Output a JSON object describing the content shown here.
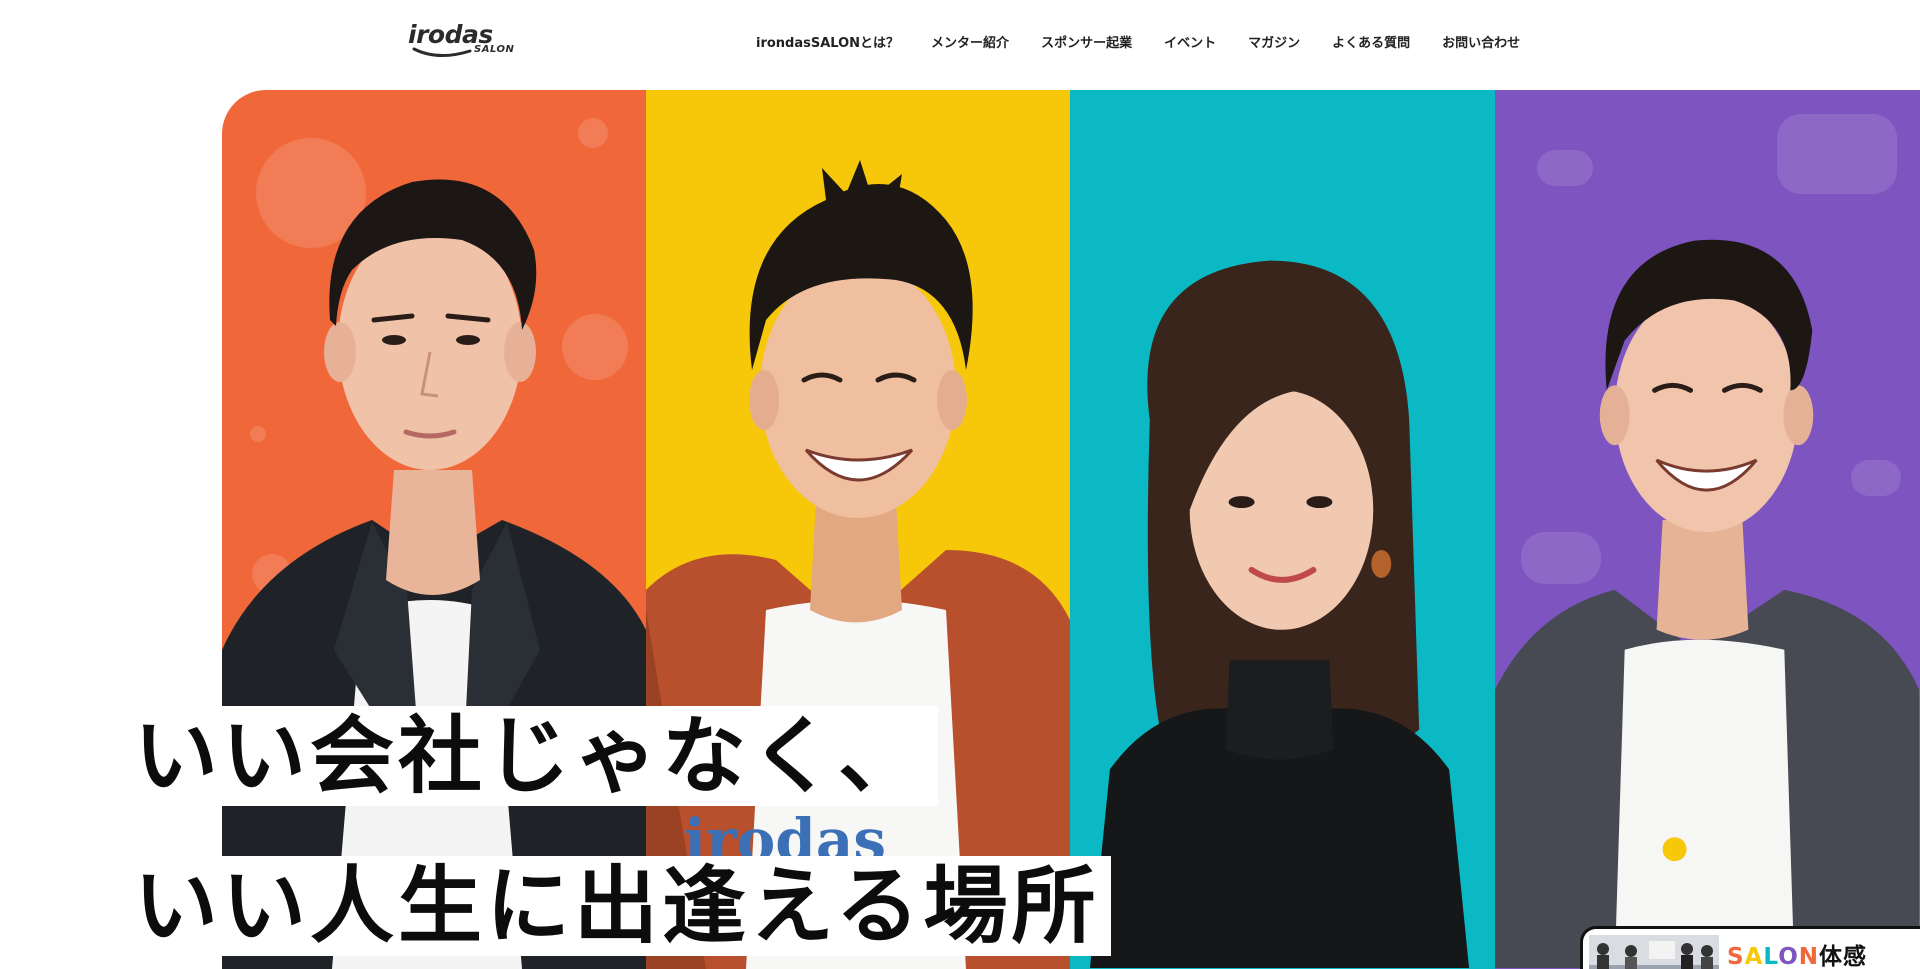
{
  "brand": {
    "logo_word": "irodas",
    "logo_sub": "SALON"
  },
  "nav": {
    "items": [
      {
        "label": "irondasSALONとは？"
      },
      {
        "label": "メンター紹介"
      },
      {
        "label": "スポンサー起業"
      },
      {
        "label": "イベント"
      },
      {
        "label": "マガジン"
      },
      {
        "label": "よくある質問"
      },
      {
        "label": "お問い合わせ"
      }
    ]
  },
  "hero": {
    "catch_line_1": "いい会社じゃなく、",
    "catch_line_2": "いい人生に出逢える場所",
    "panel_colors": [
      "#f0673a",
      "#f7c809",
      "#0ab9c3",
      "#7e54c0"
    ],
    "shirt_print": "irodas"
  },
  "trial_badge": {
    "label_parts": [
      "S",
      "A",
      "L",
      "O",
      "N",
      "体感"
    ]
  }
}
